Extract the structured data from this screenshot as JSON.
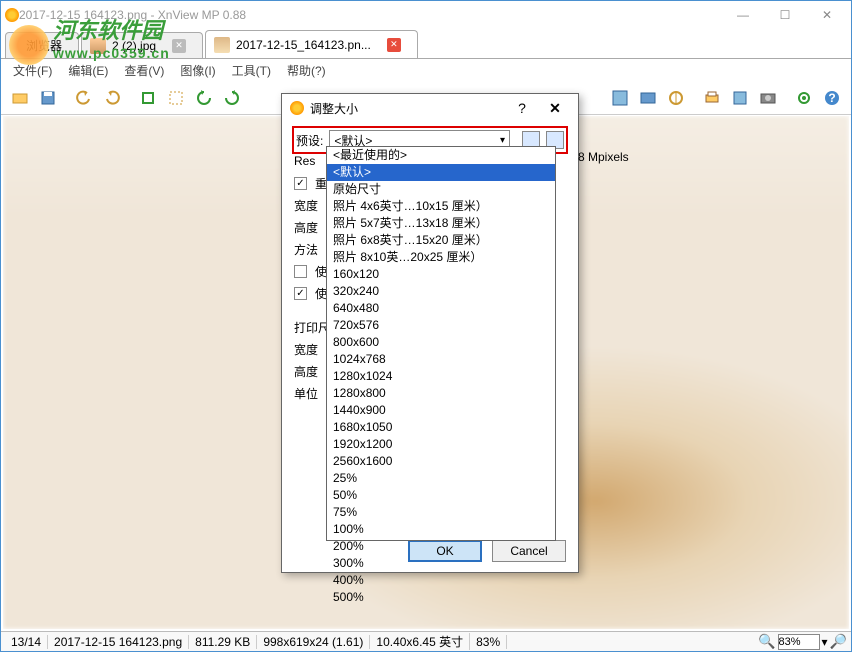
{
  "window": {
    "title": "2017-12-15 164123.png - XnView MP 0.88"
  },
  "watermark": {
    "site_cn": "河东软件园",
    "site_url": "www.pc0359.cn"
  },
  "tabs": {
    "browser": "浏览器",
    "tab1": "2 (2).jpg",
    "tab2": "2017-12-15_164123.pn..."
  },
  "menu": {
    "file": "文件(F)",
    "edit": "编辑(E)",
    "view": "查看(V)",
    "image": "图像(I)",
    "tools": "工具(T)",
    "help": "帮助(?)"
  },
  "status": {
    "index": "13/14",
    "filename": "2017-12-15 164123.png",
    "filesize": "811.29 KB",
    "dimensions": "998x619x24 (1.61)",
    "physical": "10.40x6.45 英寸",
    "zoom_pct": "83%",
    "zoom_field": "83%"
  },
  "dialog": {
    "title": "调整大小",
    "preset_label": "预设:",
    "preset_value": "<默认>",
    "res_line": "Res",
    "mpixels": "8 Mpixels",
    "checkbox_resample": "重新",
    "width_label": "宽度",
    "height_label": "高度",
    "method_label": "方法",
    "keep_checkbox": "使",
    "keep2_checkbox": "使",
    "print_label": "打印尺",
    "unit_label": "单位",
    "ok": "OK",
    "cancel": "Cancel"
  },
  "dropdown": {
    "recent": "<最近使用的>",
    "selected": "<默认>",
    "original": "原始尺寸",
    "photo1": "照片   4x6英寸…10x15 厘米）",
    "photo2": "照片   5x7英寸…13x18 厘米）",
    "photo3": "照片   6x8英寸…15x20 厘米）",
    "photo4": "照片   8x10英…20x25 厘米）",
    "sizes": [
      "160x120",
      "320x240",
      "640x480",
      "720x576",
      "800x600",
      "1024x768",
      "1280x1024",
      "1280x800",
      "1440x900",
      "1680x1050",
      "1920x1200",
      "2560x1600"
    ],
    "percents": [
      "25%",
      "50%",
      "75%",
      "100%",
      "200%",
      "300%",
      "400%",
      "500%"
    ]
  }
}
